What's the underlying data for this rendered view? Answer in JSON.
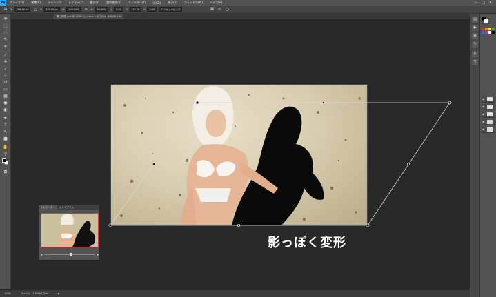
{
  "app": {
    "logo": "Ps"
  },
  "menubar": {
    "items": [
      "ファイル(F)",
      "編集(E)",
      "イメージ(I)",
      "レイヤー(L)",
      "書式(Y)",
      "選択範囲(S)",
      "フィルター(T)",
      "3D(D)",
      "表示(V)",
      "ウィンドウ(W)",
      "ヘルプ(H)"
    ],
    "window_controls": [
      "—",
      "□",
      "✕"
    ]
  },
  "options_bar": {
    "fields": [
      {
        "label": "X:",
        "value": "796.46 px"
      },
      {
        "label": "Y:",
        "value": "333.50 px"
      },
      {
        "label": "W:",
        "value": "100.00%"
      },
      {
        "label": "H:",
        "value": "96.88%"
      },
      {
        "label": "∠",
        "value": "0.00"
      },
      {
        "label": "H:",
        "value": "-25.00"
      },
      {
        "label": "V:",
        "value": "0.00"
      }
    ],
    "interpolation": "バイキュービック",
    "icons": [
      "warp-icon",
      "cancel-icon",
      "commit-icon"
    ]
  },
  "document": {
    "tab_label": "黒い砂漠.psd @ 100% (レイヤー 1 のコピー, RGB/8) * ✕"
  },
  "toolbar": {
    "tools": [
      "move-tool-icon",
      "marquee-tool-icon",
      "lasso-tool-icon",
      "quick-select-tool-icon",
      "crop-tool-icon",
      "eyedropper-tool-icon",
      "healing-brush-tool-icon",
      "brush-tool-icon",
      "clone-stamp-tool-icon",
      "history-brush-tool-icon",
      "eraser-tool-icon",
      "gradient-tool-icon",
      "blur-tool-icon",
      "dodge-tool-icon",
      "pen-tool-icon",
      "type-tool-icon",
      "path-select-tool-icon",
      "shape-tool-icon",
      "hand-tool-icon",
      "zoom-tool-icon"
    ],
    "foreground_color": "#000000",
    "background_color": "#ffffff"
  },
  "navigator": {
    "tabs": [
      "ナビゲーター",
      "ヒストグラム"
    ],
    "zoom_percent": 50
  },
  "status": {
    "zoom": "100%",
    "doc_info": "ファイル : 2.64M/5.28M"
  },
  "right_panel": {
    "swatch_colors": [
      "#e03030",
      "#f08a20",
      "#f0e020",
      "#40b040",
      "#3070e0",
      "#a040c0",
      "#ffffff",
      "#000000"
    ],
    "layer_count": 5
  },
  "caption": {
    "text": "影っぽく変形"
  },
  "colors": {
    "accent": "#31a8ff",
    "chrome": "#535353",
    "canvas_bg": "#282828",
    "selection_frame": "#d34444"
  }
}
